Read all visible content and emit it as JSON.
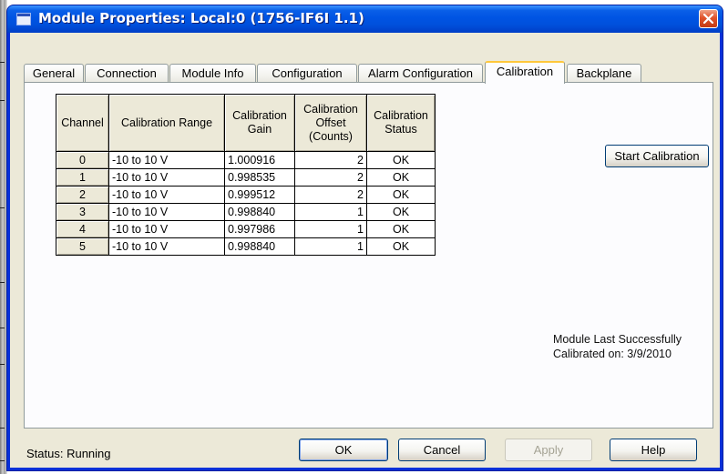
{
  "window": {
    "title": "Module Properties: Local:0 (1756-IF6I 1.1)"
  },
  "tabs": [
    {
      "label": "General"
    },
    {
      "label": "Connection"
    },
    {
      "label": "Module Info"
    },
    {
      "label": "Configuration"
    },
    {
      "label": "Alarm Configuration"
    },
    {
      "label": "Calibration",
      "active": true
    },
    {
      "label": "Backplane"
    }
  ],
  "calibration": {
    "columns": [
      "Channel",
      "Calibration Range",
      "Calibration Gain",
      "Calibration Offset (Counts)",
      "Calibration Status"
    ],
    "column_lines": [
      [
        "Channel"
      ],
      [
        "Calibration Range"
      ],
      [
        "Calibration",
        "Gain"
      ],
      [
        "Calibration",
        "Offset",
        "(Counts)"
      ],
      [
        "Calibration",
        "Status"
      ]
    ],
    "rows": [
      {
        "channel": "0",
        "range": "-10 to 10 V",
        "gain": "1.000916",
        "offset": "2",
        "status": "OK"
      },
      {
        "channel": "1",
        "range": "-10 to 10 V",
        "gain": "0.998535",
        "offset": "2",
        "status": "OK"
      },
      {
        "channel": "2",
        "range": "-10 to 10 V",
        "gain": "0.999512",
        "offset": "2",
        "status": "OK"
      },
      {
        "channel": "3",
        "range": "-10 to 10 V",
        "gain": "0.998840",
        "offset": "1",
        "status": "OK"
      },
      {
        "channel": "4",
        "range": "-10 to 10 V",
        "gain": "0.997986",
        "offset": "1",
        "status": "OK"
      },
      {
        "channel": "5",
        "range": "-10 to 10 V",
        "gain": "0.998840",
        "offset": "1",
        "status": "OK"
      }
    ],
    "start_button": "Start Calibration",
    "last_calibrated_line1": "Module Last Successfully",
    "last_calibrated_line2": "Calibrated on:  3/9/2010"
  },
  "footer": {
    "status": "Status:  Running",
    "ok": "OK",
    "cancel": "Cancel",
    "apply": "Apply",
    "help": "Help"
  },
  "colors": {
    "titlebar": "#0054e3",
    "dialog_bg": "#ece9d8",
    "active_tab_accent": "#ffc83c",
    "close_button": "#e0532b"
  }
}
